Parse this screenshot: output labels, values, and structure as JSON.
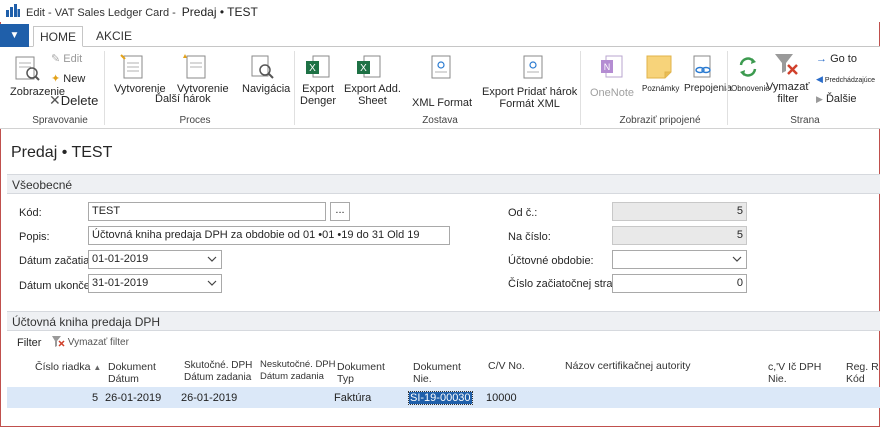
{
  "window": {
    "title": "Edit - VAT Sales Ledger Card -",
    "subtitle": "Predaj • TEST"
  },
  "ribbon_tabs": [
    "HOME",
    "AKCIE"
  ],
  "ribbon": {
    "zobrazenie": "Zobrazenie",
    "edit": "Edit",
    "new": "New",
    "delete": "Delete",
    "vytvorenie1": "Vytvorenie",
    "vytvorenie2": "Vytvorenie",
    "dalsi_harok": "Ďalší hárok",
    "navigacia": "Navigácia",
    "export_denger_1": "Export",
    "export_denger_2": "Denger",
    "export_add_1": "Export Add.",
    "export_add_2": "Sheet",
    "xml_format": "XML Format",
    "export_pridat_1": "Export Pridať hárok",
    "export_pridat_2": "Formát XML",
    "onenote": "OneNote",
    "poznamky": "Poznámky",
    "prepojenia": "Prepojenia",
    "obnovenie": "Obnovenie",
    "vymazat_filter_1": "Vymazať",
    "vymazat_filter_2": "filter",
    "go_to": "Go to",
    "predchadzajuce": "Predchádzajúce",
    "dalsie": "Ďalšie",
    "groups": {
      "spravovanie": "Spravovanie",
      "proces": "Proces",
      "zostava": "Zostava",
      "zobrazit": "Zobraziť pripojené",
      "strana": "Strana"
    }
  },
  "page_title": "Predaj • TEST",
  "general": {
    "section_title": "Všeobecné",
    "kod_label": "Kód:",
    "kod_value": "TEST",
    "assist_label": "...",
    "popis_label": "Popis:",
    "popis_value": "Účtovná kniha predaja DPH za obdobie od 01 •01 •19 do 31 Old 19",
    "datum_zac_label": "Dátum začatia:",
    "datum_zac_value": "01-01-2019",
    "datum_ukon_label": "Dátum ukončenia:",
    "datum_ukon_value": "31-01-2019",
    "od_c_label": "Od č.:",
    "od_c_value": "5",
    "na_cislo_label": "Na číslo:",
    "na_cislo_value": "5",
    "uctovne_obdobie_label": "Účtovné obdobie:",
    "uctovne_obdobie_value": "",
    "cislo_zac_strany_label": "Číslo začiatočnej strany:",
    "cislo_zac_strany_value": "0"
  },
  "ledger": {
    "section_title": "Účtovná kniha predaja DPH",
    "filter_label": "Filter",
    "clear_filter_label": "Vymazať filter",
    "columns": {
      "cislo_riadka": "Číslo riadka",
      "dokument_datum_1": "Dokument",
      "dokument_datum_2": "Dátum",
      "skutocne_dph_1": "Skutočné. DPH",
      "skutocne_dph_2": "Dátum zadania",
      "neskutocne_dph_1": "Neskutočné. DPH",
      "neskutocne_dph_2": "Dátum zadania",
      "dokument_typ_1": "Dokument",
      "dokument_typ_2": "Typ",
      "dokument_nie_1": "Dokument",
      "dokument_nie_2": "Nie.",
      "cv_no": "C/V No.",
      "nazov_cert": "Názov certifikačnej autority",
      "cv_ic_dph_1": "c,'V Ič DPH",
      "cv_ic_dph_2": "Nie.",
      "reg_kod_1": "Reg. R",
      "reg_kod_2": "Kód"
    },
    "rows": [
      {
        "cislo_riadka": "5",
        "dokument_datum": "26-01-2019",
        "skutocne_dph": "26-01-2019",
        "dokument_typ": "Faktúra",
        "dokument_nie": "SI-19-00030",
        "cv_no": "10000"
      }
    ]
  },
  "colors": {
    "accent": "#1f5faa",
    "section_bg": "#eef0f3",
    "row_selected": "#dbe8f8"
  }
}
